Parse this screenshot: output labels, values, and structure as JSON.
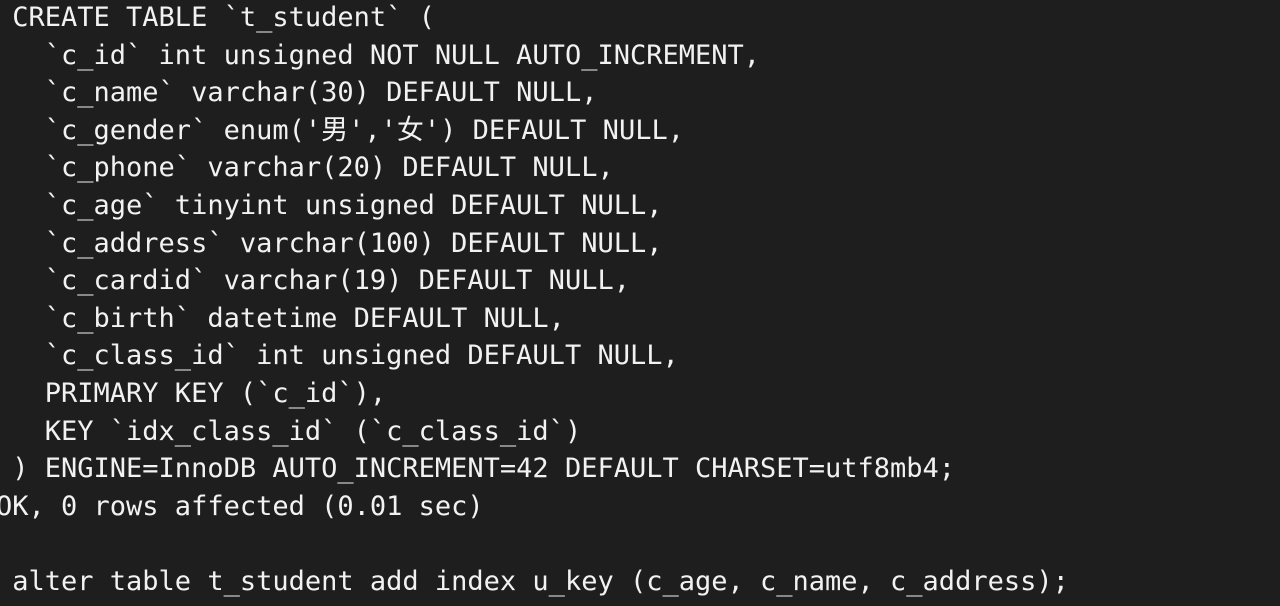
{
  "terminal": {
    "lines": [
      " CREATE TABLE `t_student` (",
      "   `c_id` int unsigned NOT NULL AUTO_INCREMENT,",
      "   `c_name` varchar(30) DEFAULT NULL,",
      "   `c_gender` enum('男','女') DEFAULT NULL,",
      "   `c_phone` varchar(20) DEFAULT NULL,",
      "   `c_age` tinyint unsigned DEFAULT NULL,",
      "   `c_address` varchar(100) DEFAULT NULL,",
      "   `c_cardid` varchar(19) DEFAULT NULL,",
      "   `c_birth` datetime DEFAULT NULL,",
      "   `c_class_id` int unsigned DEFAULT NULL,",
      "   PRIMARY KEY (`c_id`),",
      "   KEY `idx_class_id` (`c_class_id`)",
      " ) ENGINE=InnoDB AUTO_INCREMENT=42 DEFAULT CHARSET=utf8mb4;",
      "OK, 0 rows affected (0.01 sec)",
      "",
      " alter table t_student add index u_key (c_age, c_name, c_address);"
    ],
    "colors": {
      "background": "#1e1e1e",
      "text": "#f2f2f2"
    }
  }
}
